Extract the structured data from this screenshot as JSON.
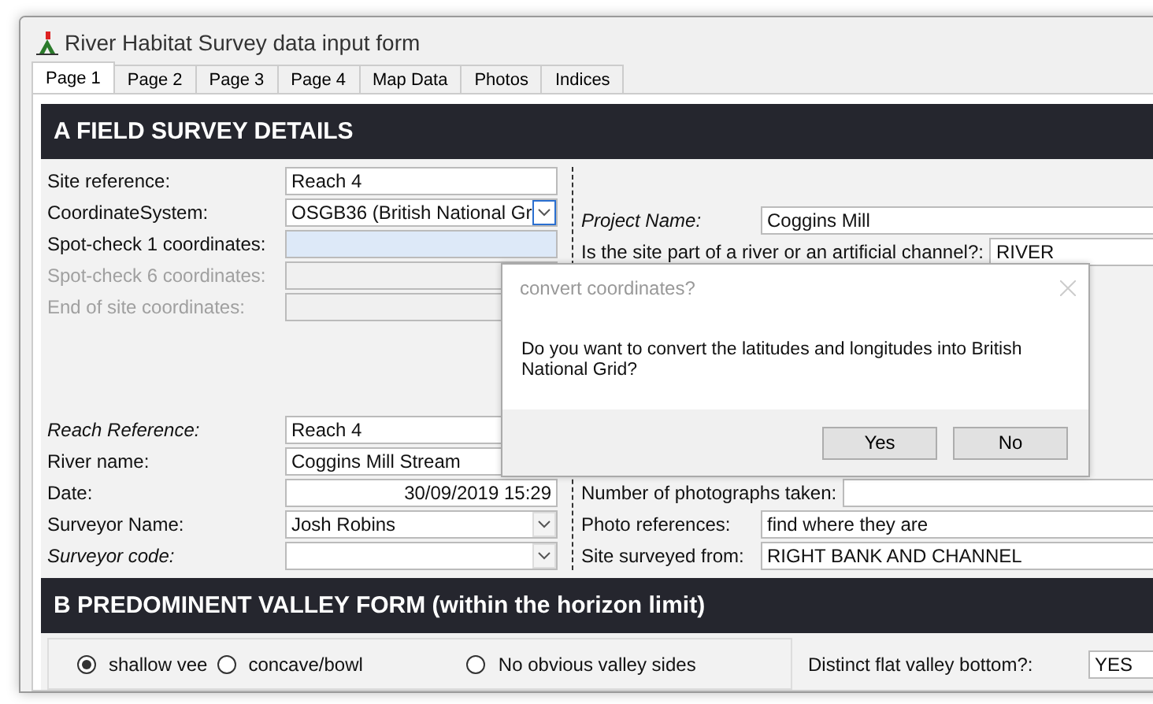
{
  "window": {
    "title": "River Habitat Survey data input form"
  },
  "tabs": [
    {
      "label": "Page 1",
      "selected": true
    },
    {
      "label": "Page 2",
      "selected": false
    },
    {
      "label": "Page 3",
      "selected": false
    },
    {
      "label": "Page 4",
      "selected": false
    },
    {
      "label": "Map Data",
      "selected": false
    },
    {
      "label": "Photos",
      "selected": false
    },
    {
      "label": "Indices",
      "selected": false
    }
  ],
  "section_a": {
    "heading": "A  FIELD SURVEY DETAILS",
    "left_top": [
      {
        "label": "Site reference:",
        "kind": "text",
        "value": "Reach 4",
        "italic": false,
        "disabled": false,
        "focused": false
      },
      {
        "label": "CoordinateSystem:",
        "kind": "dropdown",
        "value": "OSGB36 (British National Gr",
        "italic": false,
        "disabled": false,
        "focused": true
      },
      {
        "label": "Spot-check 1 coordinates:",
        "kind": "text",
        "italic": false,
        "disabled": false,
        "focused": true
      },
      {
        "label": "Spot-check 6 coordinates:",
        "kind": "text",
        "italic": false,
        "disabled": true,
        "focused": false
      },
      {
        "label": "End of site coordinates:",
        "kind": "text",
        "italic": false,
        "disabled": true,
        "focused": false
      }
    ],
    "left_bottom": [
      {
        "label": "Reach Reference:",
        "kind": "text",
        "value": "Reach 4",
        "italic": true,
        "disabled": false,
        "focused": false
      },
      {
        "label": "River name:",
        "kind": "text",
        "value": "Coggins Mill Stream",
        "italic": false,
        "disabled": false,
        "focused": false
      },
      {
        "label": "Date:",
        "kind": "date",
        "value": "30/09/2019 15:29",
        "italic": false,
        "disabled": false,
        "focused": false
      },
      {
        "label": "Surveyor Name:",
        "kind": "dropdown",
        "value": "Josh Robins",
        "italic": false,
        "disabled": false,
        "focused": false
      },
      {
        "label": "Surveyor code:",
        "kind": "dropdown",
        "italic": true,
        "disabled": false,
        "focused": false
      }
    ],
    "right_top": [
      {
        "label": "Project Name:",
        "kind": "text",
        "value": "Coggins Mill",
        "italic": true,
        "disabled": false,
        "focused": false
      },
      {
        "label": "Is the site part of a river or an artificial channel?:",
        "kind": "text",
        "value": "RIVER",
        "italic": false,
        "disabled": false,
        "focused": false
      }
    ],
    "right_bottom": [
      {
        "label": "Number of photographs taken:",
        "kind": "text",
        "italic": false,
        "disabled": false,
        "focused": false
      },
      {
        "label": "Photo references:",
        "kind": "text",
        "value": "find where they are",
        "italic": false,
        "disabled": false,
        "focused": false
      },
      {
        "label": "Site surveyed from:",
        "kind": "text",
        "value": "RIGHT BANK AND CHANNEL",
        "italic": false,
        "disabled": false,
        "focused": false
      }
    ]
  },
  "section_b": {
    "heading": "B  PREDOMINENT VALLEY FORM (within the horizon limit)",
    "options": [
      {
        "label": "shallow vee",
        "selected": true
      },
      {
        "label": "concave/bowl",
        "selected": false
      },
      {
        "label": "No obvious valley sides",
        "selected": false
      }
    ],
    "flat_bottom": {
      "label": "Distinct flat valley bottom?:",
      "value": "YES"
    }
  },
  "dialog": {
    "title": "convert coordinates?",
    "message": "Do you want to convert the latitudes and longitudes into British National Grid?",
    "buttons": [
      "Yes",
      "No"
    ]
  }
}
